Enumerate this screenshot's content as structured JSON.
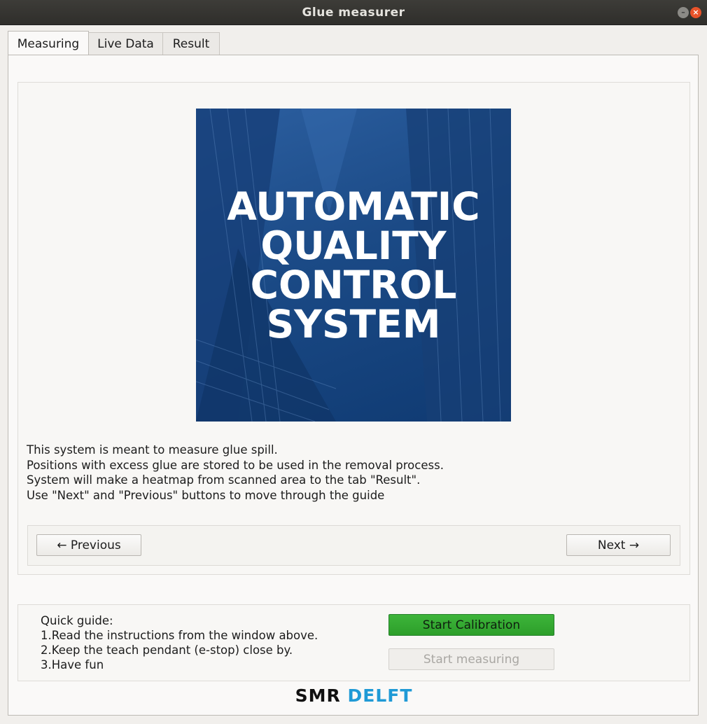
{
  "window": {
    "title": "Glue measurer"
  },
  "tabs": [
    {
      "label": "Measuring",
      "active": true
    },
    {
      "label": "Live Data",
      "active": false
    },
    {
      "label": "Result",
      "active": false
    }
  ],
  "hero": {
    "lines": [
      "AUTOMATIC",
      "QUALITY",
      "CONTROL",
      "SYSTEM"
    ],
    "background_color": "#1b4a86"
  },
  "description": [
    "This system is meant to measure glue spill.",
    "Positions with excess glue are stored to be used in the removal process.",
    "System will make a heatmap from scanned area to the tab \"Result\".",
    "Use \"Next\" and \"Previous\" buttons to move through the guide"
  ],
  "nav": {
    "previous_label": "← Previous",
    "next_label": "Next →"
  },
  "quick_guide": {
    "lines": [
      "Quick guide:",
      "1.Read the instructions from the window above.",
      "2.Keep the teach pendant (e-stop) close by.",
      "3.Have fun"
    ]
  },
  "actions": {
    "start_calibration_label": "Start Calibration",
    "start_calibration_color": "#2d9f2a",
    "start_measuring_label": "Start measuring",
    "start_measuring_enabled": false
  },
  "logo": {
    "part1": "SMR",
    "part2": "DELFT",
    "part2_color": "#1f9ad6"
  }
}
